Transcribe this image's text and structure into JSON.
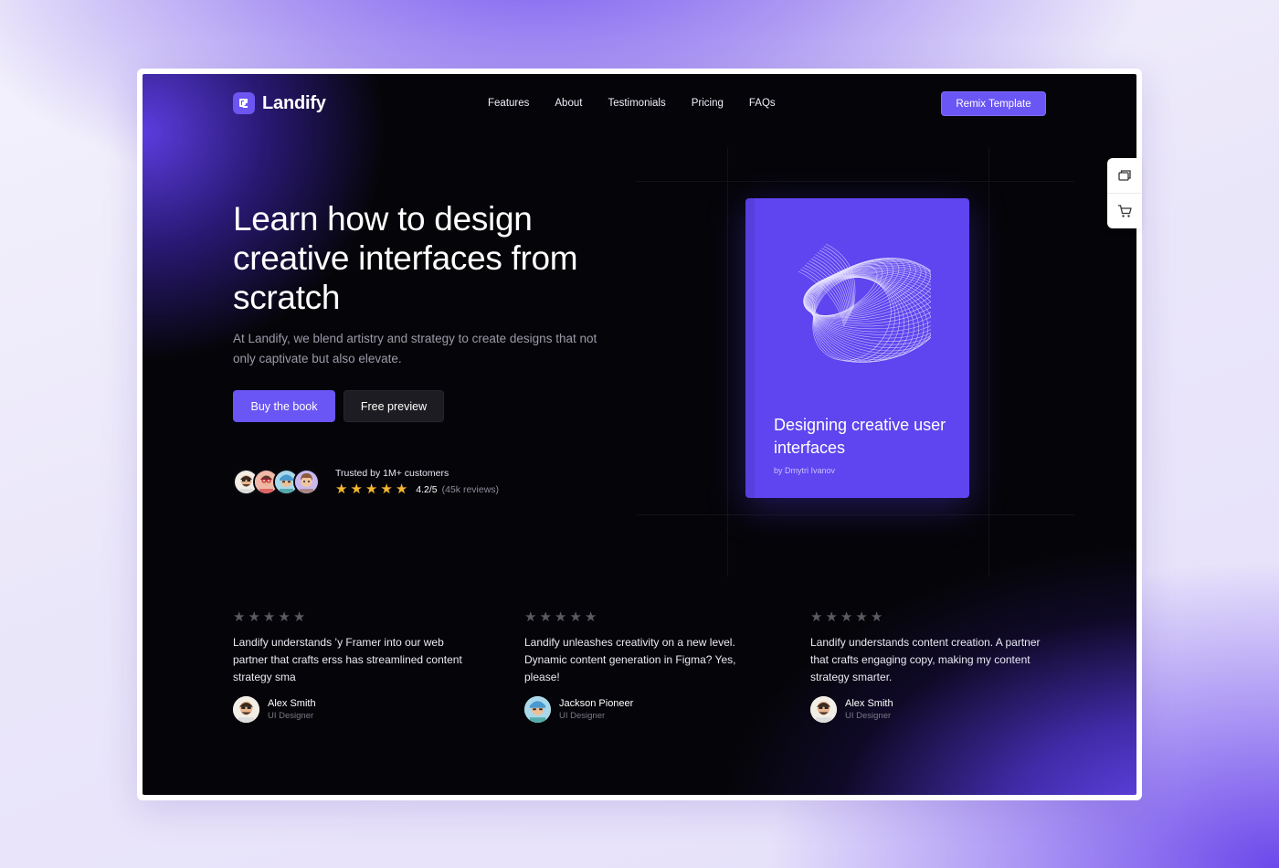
{
  "header": {
    "logo_text": "Landify",
    "nav": [
      "Features",
      "About",
      "Testimonials",
      "Pricing",
      "FAQs"
    ],
    "cta_label": "Remix Template"
  },
  "hero": {
    "title": "Learn how to design creative interfaces from scratch",
    "subtitle": "At Landify, we blend artistry and strategy to create designs that not only captivate but also elevate.",
    "primary_label": "Buy the book",
    "secondary_label": "Free preview",
    "trust_label": "Trusted by 1M+ customers",
    "rating_stars": 5,
    "rating_value": "4.2/5",
    "rating_reviews": "(45k reviews)"
  },
  "book": {
    "title": "Designing creative user interfaces",
    "author": "by Dmytri Ivanov"
  },
  "testimonials": [
    {
      "text": "Landify understands ’y Framer into our web partner that crafts erss has streamlined content strategy sma",
      "name": "Alex Smith",
      "role": "UI Designer"
    },
    {
      "text": "Landify unleashes creativity on a new level. Dynamic content generation in Figma? Yes, please!",
      "name": "Jackson Pioneer",
      "role": "UI Designer"
    },
    {
      "text": "Landify understands content creation. A partner that crafts engaging copy, making my content strategy smarter.",
      "name": "Alex Smith",
      "role": "UI Designer"
    }
  ],
  "side_tools": [
    "layers-icon",
    "cart-icon"
  ],
  "colors": {
    "accent": "#6a55f5",
    "book_cover": "#5e45ef",
    "star_gold": "#f5b82e",
    "background_dark": "#050509"
  }
}
